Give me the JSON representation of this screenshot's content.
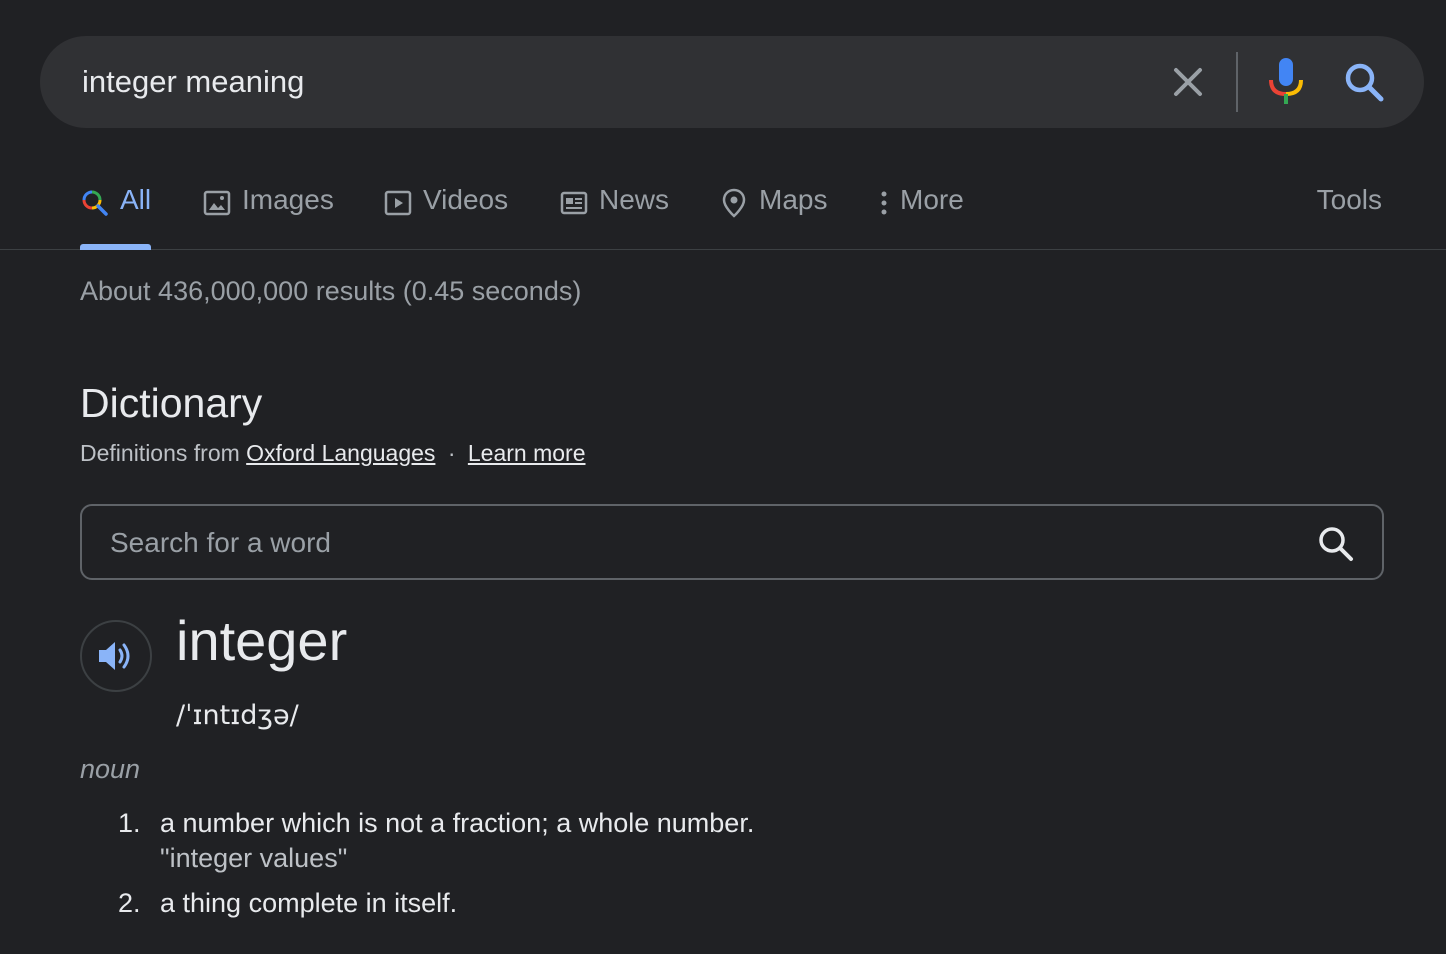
{
  "search": {
    "query": "integer meaning"
  },
  "tabs": [
    {
      "label": "All",
      "icon": "search-icon",
      "active": true
    },
    {
      "label": "Images",
      "icon": "image-icon"
    },
    {
      "label": "Videos",
      "icon": "video-icon"
    },
    {
      "label": "News",
      "icon": "news-icon"
    },
    {
      "label": "Maps",
      "icon": "map-pin-icon"
    },
    {
      "label": "More",
      "icon": "more-vert-icon"
    }
  ],
  "tools_label": "Tools",
  "result_stats": "About 436,000,000 results (0.45 seconds)",
  "dictionary": {
    "title": "Dictionary",
    "source_prefix": "Definitions from",
    "source_link": "Oxford Languages",
    "separator": "·",
    "learn_more": "Learn more",
    "search_placeholder": "Search for a word",
    "word": "integer",
    "phonetic": "/ˈɪntɪdʒə/",
    "part_of_speech": "noun",
    "definitions": [
      {
        "number": "1.",
        "text": "a number which is not a fraction; a whole number.",
        "example": "\"integer values\""
      },
      {
        "number": "2.",
        "text": "a thing complete in itself."
      }
    ]
  },
  "colors": {
    "background": "#202124",
    "searchbar": "#303134",
    "accent": "#8ab4f8",
    "text_primary": "#e8eaed",
    "text_secondary": "#9aa0a6"
  }
}
